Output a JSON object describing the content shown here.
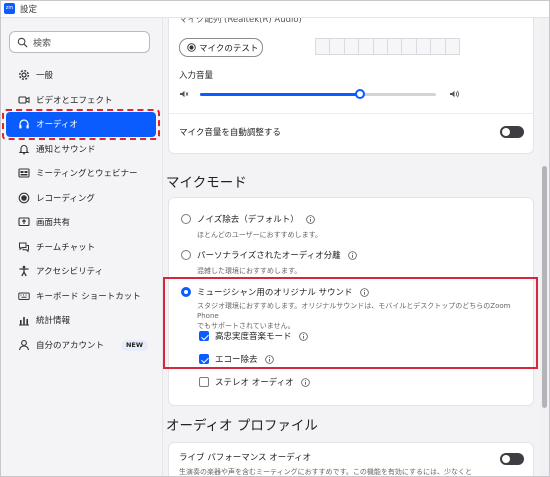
{
  "window": {
    "logo": "zm",
    "title": "設定"
  },
  "sidebar": {
    "search_placeholder": "検索",
    "items": [
      {
        "label": "一般",
        "icon": "gear-icon"
      },
      {
        "label": "ビデオとエフェクト",
        "icon": "video-camera-icon"
      },
      {
        "label": "オーディオ",
        "icon": "headphones-icon",
        "active": true
      },
      {
        "label": "通知とサウンド",
        "icon": "bell-icon"
      },
      {
        "label": "ミーティングとウェビナー",
        "icon": "meeting-icon"
      },
      {
        "label": "レコーディング",
        "icon": "record-icon"
      },
      {
        "label": "画面共有",
        "icon": "screen-share-icon"
      },
      {
        "label": "チームチャット",
        "icon": "chat-icon"
      },
      {
        "label": "アクセシビリティ",
        "icon": "accessibility-icon"
      },
      {
        "label": "キーボード ショートカット",
        "icon": "keyboard-icon"
      },
      {
        "label": "統計情報",
        "icon": "statistics-icon"
      },
      {
        "label": "自分のアカウント",
        "icon": "person-icon",
        "badge": "NEW"
      }
    ]
  },
  "mic": {
    "device": "マイク配列 (Realtek(R) Audio)",
    "test_label": "マイクのテスト",
    "input_volume_label": "入力音量",
    "input_volume_percent": 68,
    "auto_adjust_label": "マイク音量を自動調整する",
    "auto_adjust_on": false
  },
  "mic_mode": {
    "title": "マイクモード",
    "options": [
      {
        "label": "ノイズ除去（デフォルト）",
        "desc": "ほとんどのユーザーにおすすめします。",
        "selected": false
      },
      {
        "label": "パーソナライズされたオーディオ分離",
        "desc": "混雑した環境におすすめします。",
        "selected": false
      },
      {
        "label": "ミュージシャン用のオリジナル サウンド",
        "desc1": "スタジオ環境におすすめします。オリジナルサウンドは、モバイルとデスクトップのどちらのZoom Phone",
        "desc2": "でもサポートされていません。",
        "selected": true
      }
    ],
    "sub_options": [
      {
        "label": "高忠実度音楽モード",
        "checked": true
      },
      {
        "label": "エコー除去",
        "checked": true
      },
      {
        "label": "ステレオ オーディオ",
        "checked": false
      }
    ]
  },
  "audio_profile": {
    "title": "オーディオ プロファイル",
    "live_label": "ライブ パフォーマンス オーディオ",
    "live_desc": "生演奏の楽器や声を含むミーティングにおすすめです。この機能を有効にするには、少なくと",
    "live_on": false
  },
  "colors": {
    "accent": "#0b5cff",
    "highlight": "#d7283b",
    "toggle_off": "#3e3e42"
  }
}
